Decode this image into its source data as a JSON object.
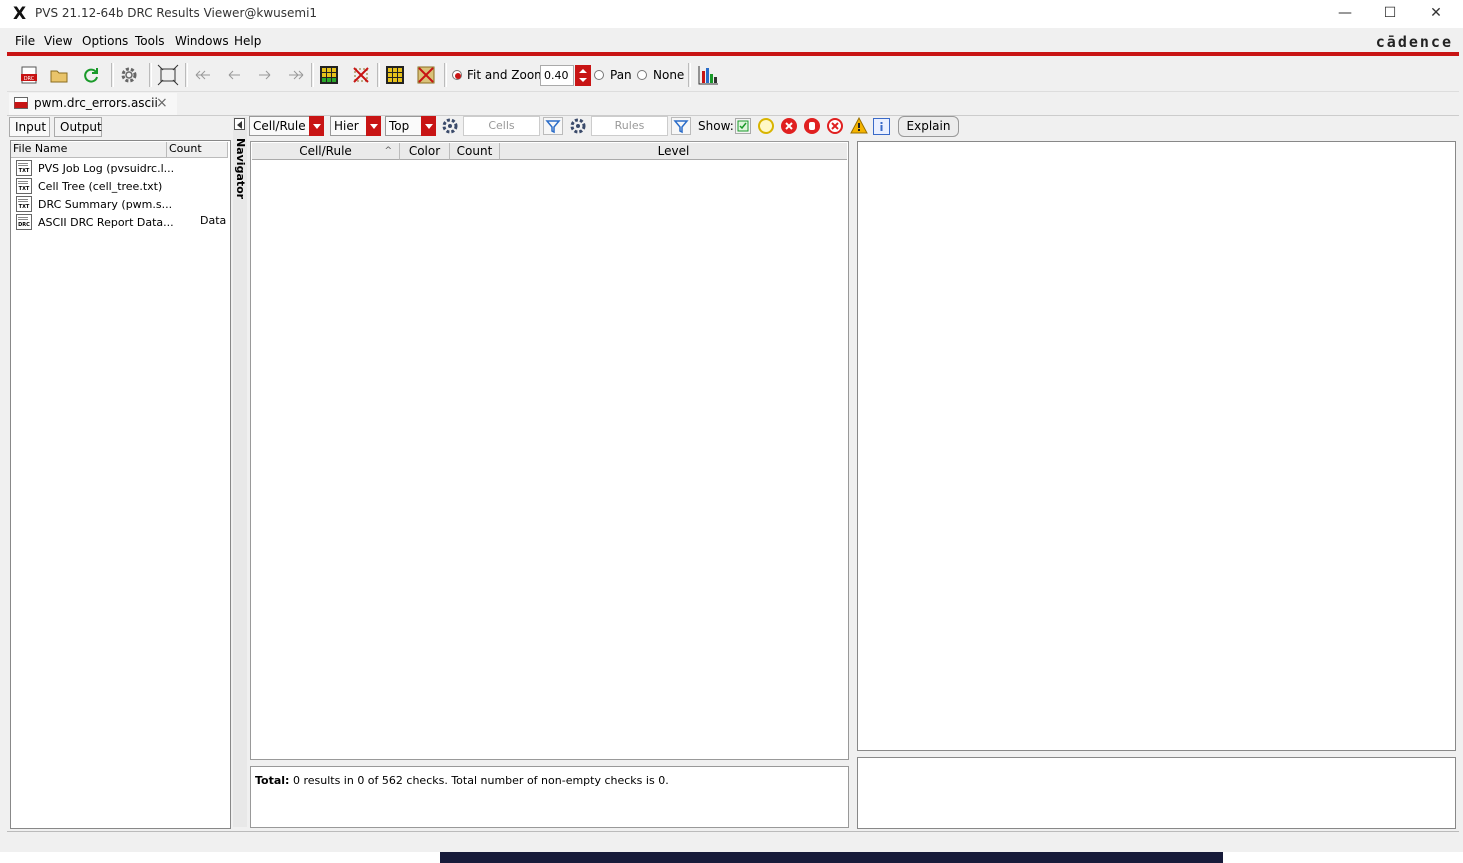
{
  "window": {
    "title": "PVS 21.12-64b DRC Results Viewer@kwusemi1",
    "app_glyph": "X",
    "controls": [
      "—",
      "☐",
      "✕"
    ]
  },
  "menu": {
    "items": [
      "File",
      "View",
      "Options",
      "Tools",
      "Windows",
      "Help"
    ],
    "brand": "cādence"
  },
  "toolbar": {
    "fit_and_zoom_label": "Fit and Zoom",
    "zoom_value": "0.40",
    "pan_label": "Pan",
    "none_label": "None",
    "selected_mode": "Fit and Zoom"
  },
  "tab": {
    "label": "pwm.drc_errors.ascii",
    "close": "×"
  },
  "left": {
    "tabs": [
      "Input",
      "Output"
    ],
    "columns": [
      "File Name",
      "Count"
    ],
    "rows": [
      {
        "icon": "TXT",
        "name": "PVS Job Log (pvsuidrc.l...",
        "count": ""
      },
      {
        "icon": "TXT",
        "name": "Cell Tree (cell_tree.txt)",
        "count": ""
      },
      {
        "icon": "TXT",
        "name": "DRC Summary (pwm.s...",
        "count": ""
      },
      {
        "icon": "DRC",
        "name": "ASCII DRC Report Data...",
        "count": "Data"
      }
    ]
  },
  "navigator": {
    "label": "Navigator"
  },
  "filters": {
    "cellrule": "Cell/Rule",
    "hier": "Hier",
    "top": "Top",
    "cells_placeholder": "Cells",
    "rules_placeholder": "Rules",
    "show_label": "Show:",
    "explain_label": "Explain"
  },
  "results_table": {
    "columns": [
      "Cell/Rule",
      "Color",
      "Count",
      "Level"
    ],
    "sort_indicator": "^",
    "rows": []
  },
  "summary": {
    "label": "Total:",
    "text": " 0 results in 0 of 562 checks. Total number of non-empty checks is 0."
  },
  "colors": {
    "accent": "#c81414",
    "title_bg": "#ffffff",
    "panel_bg": "#f0f0f0"
  }
}
